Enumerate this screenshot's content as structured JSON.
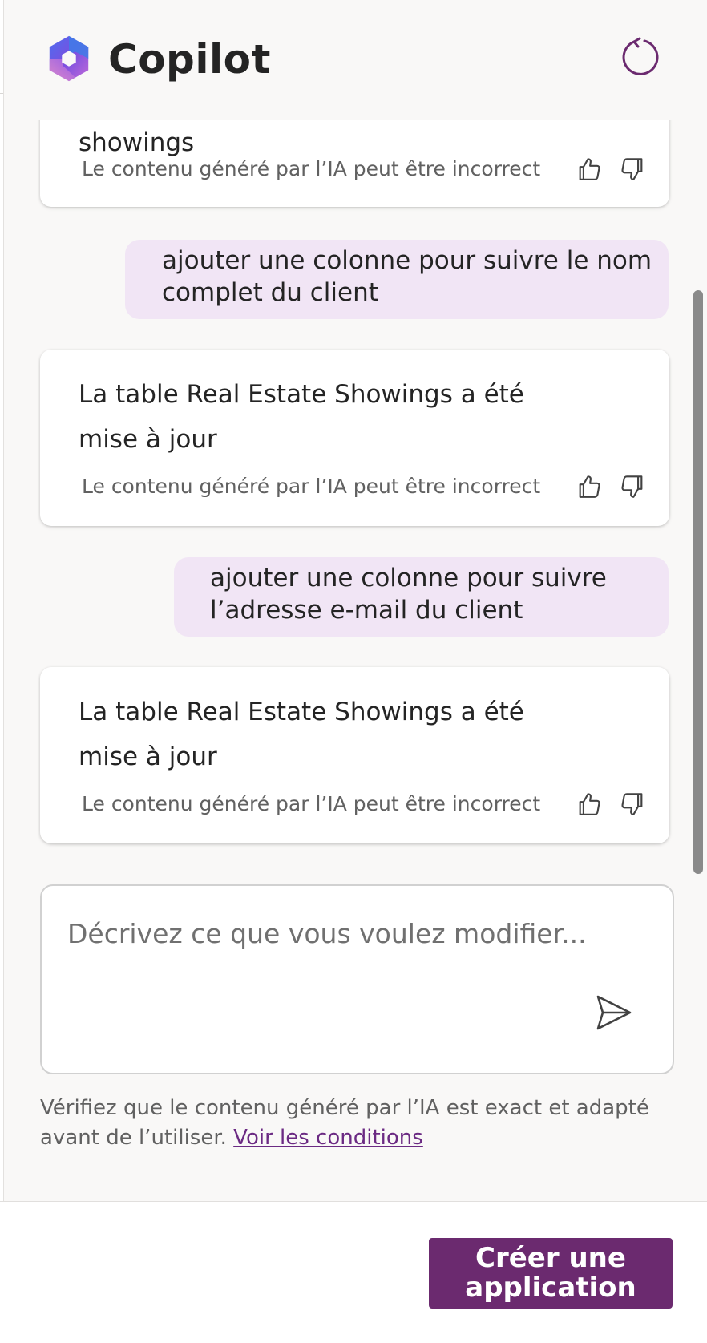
{
  "header": {
    "title": "Copilot",
    "logo_icon": "copilot-logo-icon",
    "refresh_icon": "refresh-icon"
  },
  "conversation": {
    "messages": [
      {
        "role": "assistant",
        "text": "showings",
        "disclaimer": "Le contenu généré par l’IA peut être incorrect"
      },
      {
        "role": "user",
        "text": "ajouter une colonne pour suivre le nom complet du client"
      },
      {
        "role": "assistant",
        "text": "La table Real Estate Showings a été mise à jour",
        "disclaimer": "Le contenu généré par l’IA peut être incorrect"
      },
      {
        "role": "user",
        "text": "ajouter une colonne pour suivre l’adresse e-mail du client"
      },
      {
        "role": "assistant",
        "text": "La table Real Estate Showings a été mise à jour",
        "disclaimer": "Le contenu généré par l’IA peut être incorrect"
      }
    ]
  },
  "composer": {
    "placeholder": "Décrivez ce que vous voulez modifier...",
    "send_icon": "send-icon"
  },
  "footer": {
    "note": "Vérifiez que le contenu généré par l’IA est exact et adapté avant de l’utiliser.",
    "link_text": "Voir les conditions"
  },
  "actions": {
    "create_label": "Créer une application"
  },
  "colors": {
    "accent": "#6b2a6f",
    "user_bubble": "#f1e5f5",
    "panel_bg": "#f9f8f7",
    "link": "#6b2a83"
  }
}
